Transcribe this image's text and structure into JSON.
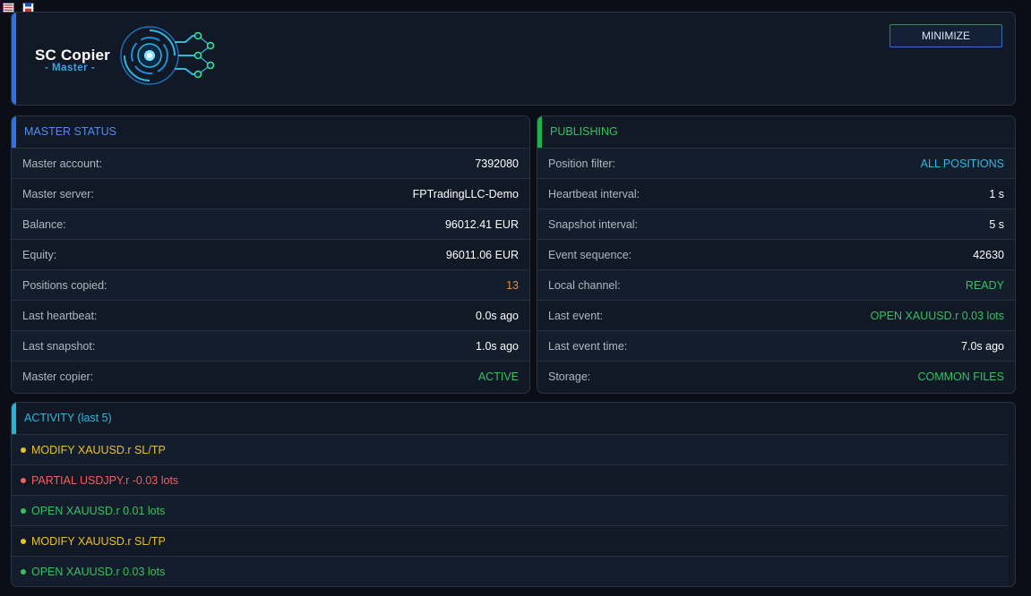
{
  "colors": {
    "blue": "#2e72e8",
    "green": "#22b04f",
    "cyan": "#1fb5d8",
    "orange": "#f0892c",
    "yellow": "#e8c02a",
    "red": "#f06060",
    "green_text": "#37c15e",
    "cyan_text": "#2fb8e0"
  },
  "header": {
    "logo_title": "SC Copier",
    "logo_subtitle": "- Master -",
    "minimize_label": "MINIMIZE"
  },
  "status": {
    "title": "MASTER STATUS",
    "rows": [
      {
        "label": "Master account:",
        "value": "7392080",
        "color": "#ffffff"
      },
      {
        "label": "Master server:",
        "value": "FPTradingLLC-Demo",
        "color": "#ffffff"
      },
      {
        "label": "Balance:",
        "value": "96012.41 EUR",
        "color": "#ffffff"
      },
      {
        "label": "Equity:",
        "value": "96011.06 EUR",
        "color": "#ffffff"
      },
      {
        "label": "Positions copied:",
        "value": "13",
        "color": "#f0892c"
      },
      {
        "label": "Last heartbeat:",
        "value": "0.0s ago",
        "color": "#ffffff"
      },
      {
        "label": "Last snapshot:",
        "value": "1.0s ago",
        "color": "#ffffff"
      },
      {
        "label": "Master copier:",
        "value": "ACTIVE",
        "color": "#37c15e"
      }
    ]
  },
  "publishing": {
    "title": "PUBLISHING",
    "rows": [
      {
        "label": "Position filter:",
        "value": "ALL POSITIONS",
        "color": "#2fb8e0"
      },
      {
        "label": "Heartbeat interval:",
        "value": "1 s",
        "color": "#ffffff"
      },
      {
        "label": "Snapshot interval:",
        "value": "5 s",
        "color": "#ffffff"
      },
      {
        "label": "Event sequence:",
        "value": "42630",
        "color": "#ffffff"
      },
      {
        "label": "Local channel:",
        "value": "READY",
        "color": "#37c15e"
      },
      {
        "label": "Last event:",
        "value": "OPEN XAUUSD.r 0.03 lots",
        "color": "#37c15e"
      },
      {
        "label": "Last event time:",
        "value": "7.0s ago",
        "color": "#ffffff"
      },
      {
        "label": "Storage:",
        "value": "COMMON FILES",
        "color": "#37c15e"
      }
    ]
  },
  "activity": {
    "title": "ACTIVITY (last 5)",
    "items": [
      {
        "text": "MODIFY XAUUSD.r SL/TP",
        "color": "#e8c02a"
      },
      {
        "text": "PARTIAL USDJPY.r -0.03 lots",
        "color": "#f06060"
      },
      {
        "text": "OPEN XAUUSD.r 0.01 lots",
        "color": "#37c15e"
      },
      {
        "text": "MODIFY XAUUSD.r SL/TP",
        "color": "#e8c02a"
      },
      {
        "text": "OPEN XAUUSD.r 0.03 lots",
        "color": "#37c15e"
      }
    ]
  }
}
